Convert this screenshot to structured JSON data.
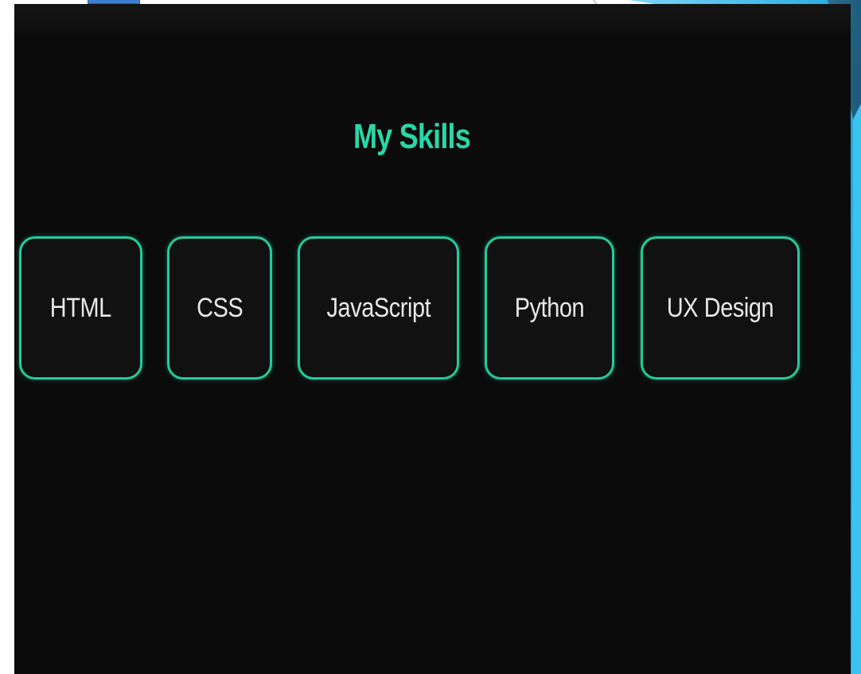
{
  "section": {
    "title": "My Skills"
  },
  "skills": [
    {
      "label": "HTML"
    },
    {
      "label": "CSS"
    },
    {
      "label": "JavaScript"
    },
    {
      "label": "Python"
    },
    {
      "label": "UX Design"
    }
  ],
  "colors": {
    "background": "#0b0b0b",
    "accent": "#26c99c",
    "title": "#2ad6a8",
    "text": "#e8e8e8",
    "slide_accent": "#29b6e8"
  }
}
